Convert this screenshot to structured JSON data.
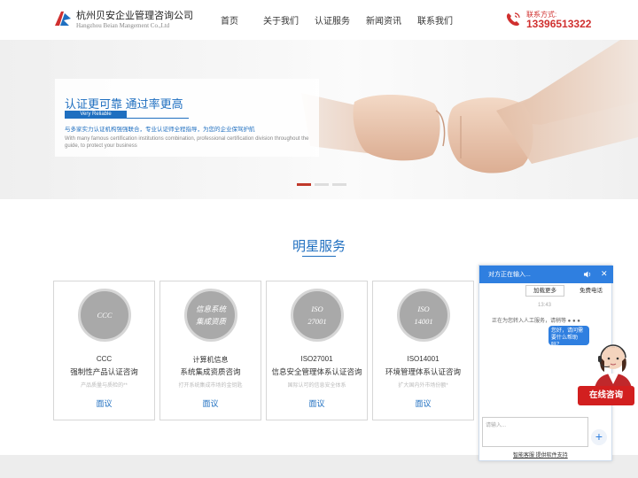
{
  "header": {
    "company_name": "杭州贝安企业管理咨询公司",
    "company_en": "Hangzhou Beian Mangement Co.,Ltd",
    "nav": [
      "首页",
      "关于我们",
      "认证服务",
      "新闻资讯",
      "联系我们"
    ],
    "contact_label": "联系方式:",
    "contact_phone": "13396513322",
    "brand_red": "#d0302f",
    "brand_blue": "#1f6fc0"
  },
  "banner": {
    "headline": "认证更可靠  通过率更高",
    "badge": "Very Reliable",
    "desc": "与多家实力认证机构强强联合，专业认证师全程指导，为您的企业保驾护航",
    "desc_en": "With many famous certification institutions combination, professional certification division throughout the guide, to protect your business",
    "slides": 3,
    "active_slide": 1
  },
  "services": {
    "title": "明星服务",
    "cards": [
      {
        "circle": "CCC",
        "code": "CCC",
        "name": "强制性产品认证咨询",
        "sub": "产品质量与质检的**",
        "button": "面议"
      },
      {
        "circle": "信息系统\n集成资质",
        "code": "计算机信息",
        "name": "系统集成资质咨询",
        "sub": "打开系统集成市场的金钥匙",
        "button": "面议"
      },
      {
        "circle": "ISO\n27001",
        "code": "ISO27001",
        "name": "信息安全管理体系认证咨询",
        "sub": "国际认可的信息安全体系",
        "button": "面议"
      },
      {
        "circle": "ISO\n14001",
        "code": "ISO14001",
        "name": "环境管理体系认证咨询",
        "sub": "扩大国内外市场份额*",
        "button": "面议"
      }
    ]
  },
  "chat": {
    "header": "对方正在输入...",
    "btn_add": "加载更多",
    "btn_call": "免费电话",
    "time": "13:43",
    "system_msg": "正在为您转入人工服务，请稍等 ● ● ●",
    "bubble": "您好，请问需要什么帮助吗？",
    "input_placeholder": "请输入...",
    "footer": "智能客服 提供软件支持",
    "online_label": "在线咨询"
  }
}
